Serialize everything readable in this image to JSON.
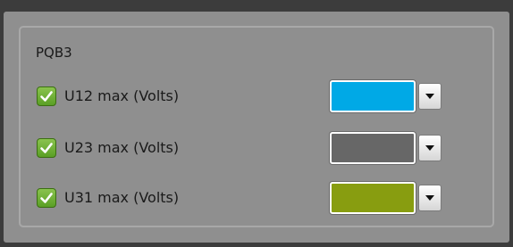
{
  "group": {
    "title": "PQB3"
  },
  "rows": [
    {
      "label": "U12 max (Volts)",
      "checked": true,
      "color": "#00a9e6"
    },
    {
      "label": "U23 max (Volts)",
      "checked": true,
      "color": "#676767"
    },
    {
      "label": "U31 max (Volts)",
      "checked": true,
      "color": "#889d10"
    }
  ],
  "icons": {
    "checkbox": "checkmark-icon",
    "dropdown": "chevron-down-icon"
  }
}
